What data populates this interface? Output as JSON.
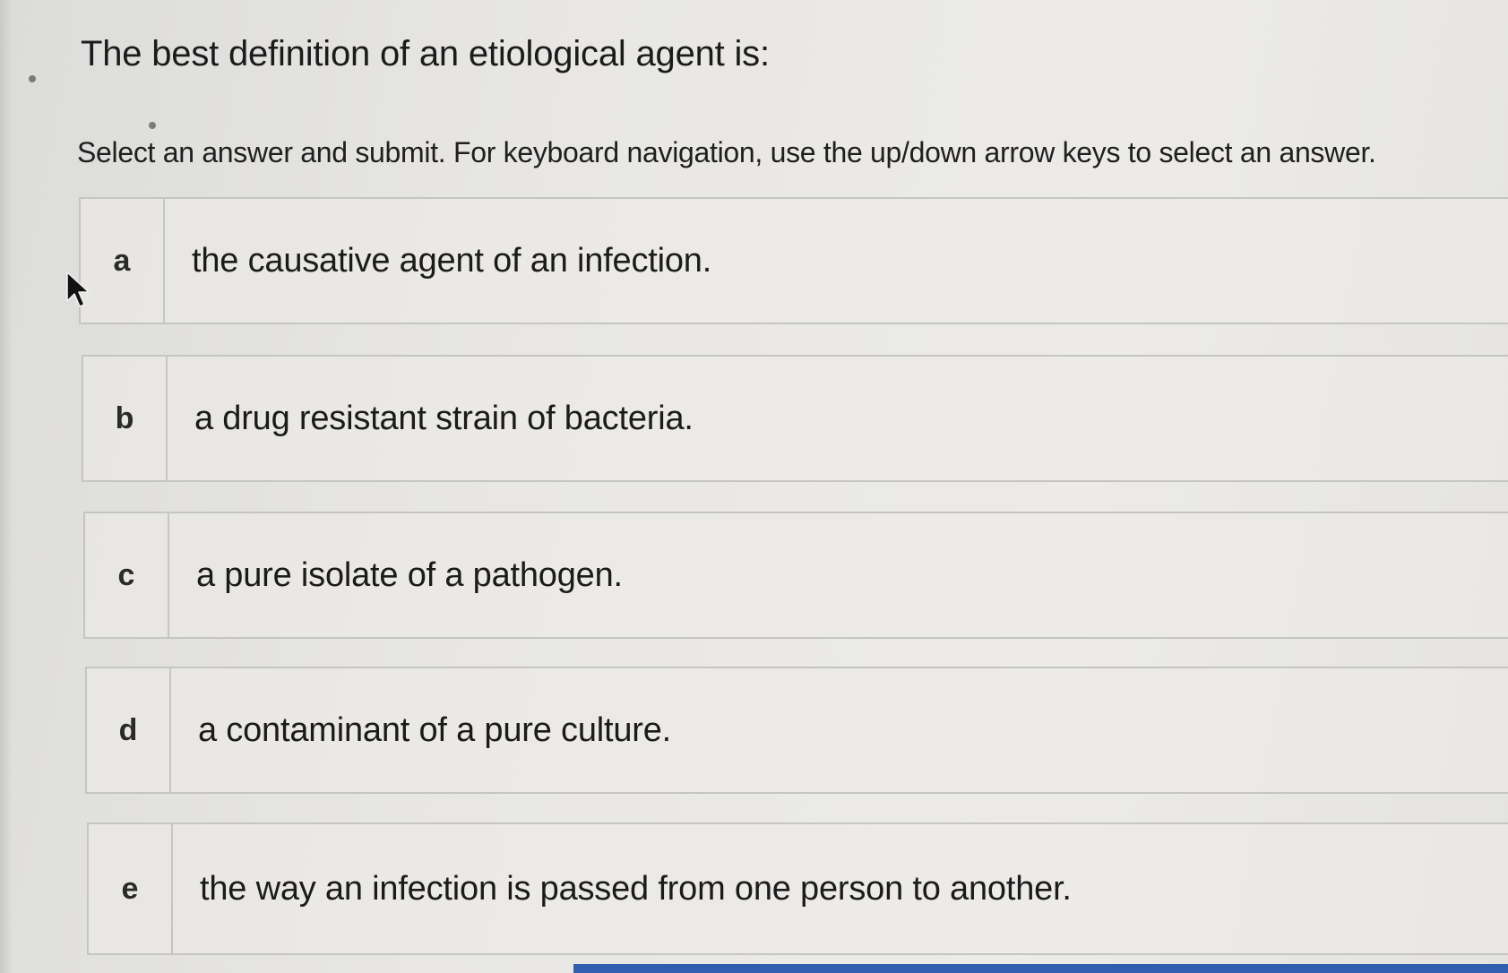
{
  "question": {
    "title": "The best definition of an etiological agent is:",
    "instructions": "Select an answer and submit. For keyboard navigation, use the up/down arrow keys to select an answer."
  },
  "choices": [
    {
      "letter": "a",
      "text": "the causative agent of an infection."
    },
    {
      "letter": "b",
      "text": "a drug resistant strain of bacteria."
    },
    {
      "letter": "c",
      "text": "a pure isolate of a pathogen."
    },
    {
      "letter": "d",
      "text": "a contaminant of a pure culture."
    },
    {
      "letter": "e",
      "text": "the way an infection is passed from one person to another."
    }
  ],
  "colors": {
    "background": "#e8e7e4",
    "border": "#c5c5c2",
    "accent_bar": "#2f5fae",
    "text": "#1b1b1b"
  },
  "icons": {
    "cursor": "mouse-pointer-icon"
  }
}
